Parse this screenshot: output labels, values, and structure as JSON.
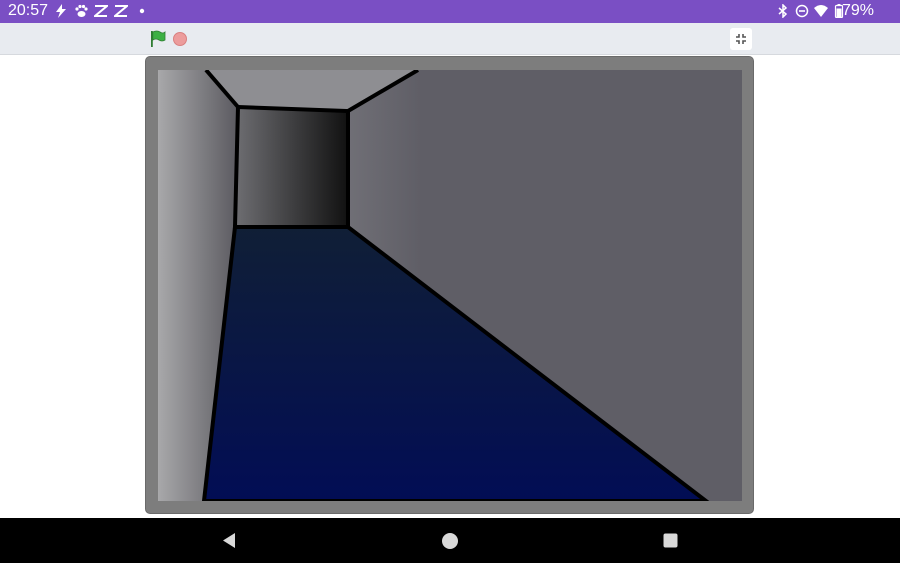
{
  "status_bar": {
    "time": "20:57",
    "left_icons": [
      "flash-icon",
      "paw-icon",
      "capcut-icon",
      "capcut-icon",
      "dot-icon"
    ],
    "right_icons": [
      "bluetooth-icon",
      "dnd-icon",
      "wifi-icon",
      "battery-icon"
    ],
    "battery_percent": "79%"
  },
  "toolbar": {
    "green_flag_icon": "green-flag-icon",
    "stop_icon": "stop-icon",
    "fullscreen_icon": "exit-fullscreen-icon"
  },
  "stage": {
    "scene": "3d-corridor",
    "colors": {
      "left_wall_light": "#a8a8aa",
      "left_wall_dark": "#5b5a60",
      "right_wall_light": "#9c9ca0",
      "right_wall_dark": "#5f5e66",
      "end_wall_light": "#6e6e72",
      "end_wall_dark": "#111111",
      "floor_top": "#101f36",
      "floor_bottom": "#020d55",
      "outline": "#000000",
      "frame": "#7d7d7d"
    }
  },
  "nav_bar": {
    "back_icon": "back-triangle-icon",
    "home_icon": "home-circle-icon",
    "recents_icon": "recents-square-icon"
  }
}
